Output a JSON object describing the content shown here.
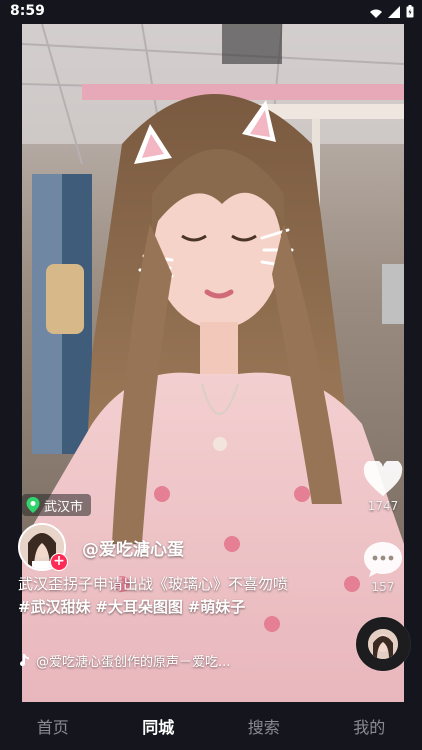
{
  "status_bar": {
    "time": "8:59"
  },
  "video": {
    "location": "武汉市",
    "author": "@爱吃溏心蛋",
    "caption_text": "武汉歪拐子申请出战《玻璃心》不喜勿喷",
    "hashtags": [
      "#武汉甜妹",
      "#大耳朵图图",
      "#萌妹子"
    ],
    "music": "@爱吃溏心蛋创作的原声－爱吃..."
  },
  "actions": {
    "like_count": "1747",
    "comment_count": "157"
  },
  "bottom_nav": {
    "items": [
      "首页",
      "同城",
      "搜索",
      "我的"
    ],
    "active": "同城"
  },
  "colors": {
    "accent": "#fe2c55",
    "background": "#15161d"
  }
}
